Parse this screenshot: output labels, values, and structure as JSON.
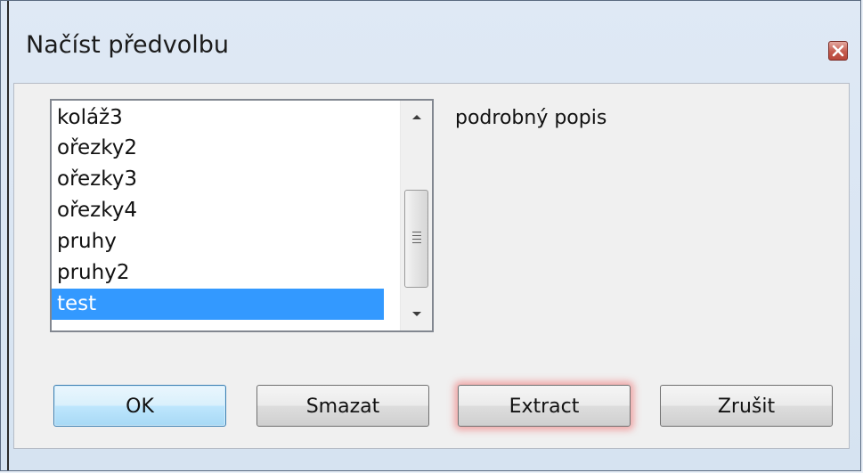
{
  "dialog": {
    "title": "Načíst předvolbu",
    "close_icon": "close-icon"
  },
  "presets": {
    "items": [
      {
        "label": "koláž3"
      },
      {
        "label": "ořezky2"
      },
      {
        "label": "ořezky3"
      },
      {
        "label": "ořezky4"
      },
      {
        "label": "pruhy"
      },
      {
        "label": "pruhy2"
      },
      {
        "label": "test"
      }
    ],
    "selected": "test"
  },
  "description": {
    "text": "podrobný popis"
  },
  "buttons": {
    "ok_label": "OK",
    "delete_label": "Smazat",
    "extract_label": "Extract",
    "cancel_label": "Zrušit"
  },
  "colors": {
    "selection": "#3399ff",
    "default_button": "#bee6fd",
    "extract_glow": "#f06e6e",
    "close_button": "#c55b4e"
  }
}
